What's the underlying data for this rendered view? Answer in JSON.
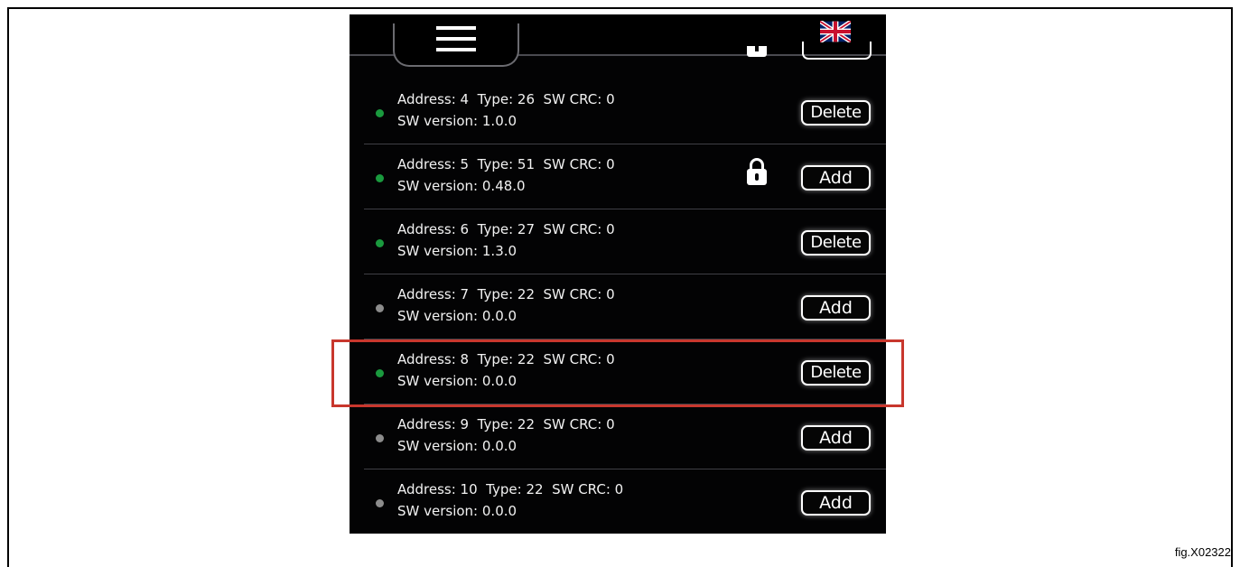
{
  "header": {
    "menu_icon": "hamburger-menu-icon",
    "language_icon": "uk-flag-icon"
  },
  "rows": [
    {
      "address_line": "Address: 4  Type: 26  SW CRC: 0",
      "version_line": "SW version: 1.0.0",
      "status": "green",
      "button": "Delete",
      "locked": false
    },
    {
      "address_line": "Address: 5  Type: 51  SW CRC: 0",
      "version_line": "SW version: 0.48.0",
      "status": "green",
      "button": "Add",
      "locked": true
    },
    {
      "address_line": "Address: 6  Type: 27  SW CRC: 0",
      "version_line": "SW version: 1.3.0",
      "status": "green",
      "button": "Delete",
      "locked": false
    },
    {
      "address_line": "Address: 7  Type: 22  SW CRC: 0",
      "version_line": "SW version: 0.0.0",
      "status": "grey",
      "button": "Add",
      "locked": false
    },
    {
      "address_line": "Address: 8  Type: 22  SW CRC: 0",
      "version_line": "SW version: 0.0.0",
      "status": "green",
      "button": "Delete",
      "locked": false
    },
    {
      "address_line": "Address: 9  Type: 22  SW CRC: 0",
      "version_line": "SW version: 0.0.0",
      "status": "grey",
      "button": "Add",
      "locked": false
    },
    {
      "address_line": "Address: 10  Type: 22  SW CRC: 0",
      "version_line": "SW version: 0.0.0",
      "status": "grey",
      "button": "Add",
      "locked": false
    }
  ],
  "colors": {
    "status_green": "#1a9a3e",
    "status_grey": "#8c8c8c",
    "highlight": "#c8372d",
    "background": "#030304"
  },
  "caption": "fig.X02322"
}
